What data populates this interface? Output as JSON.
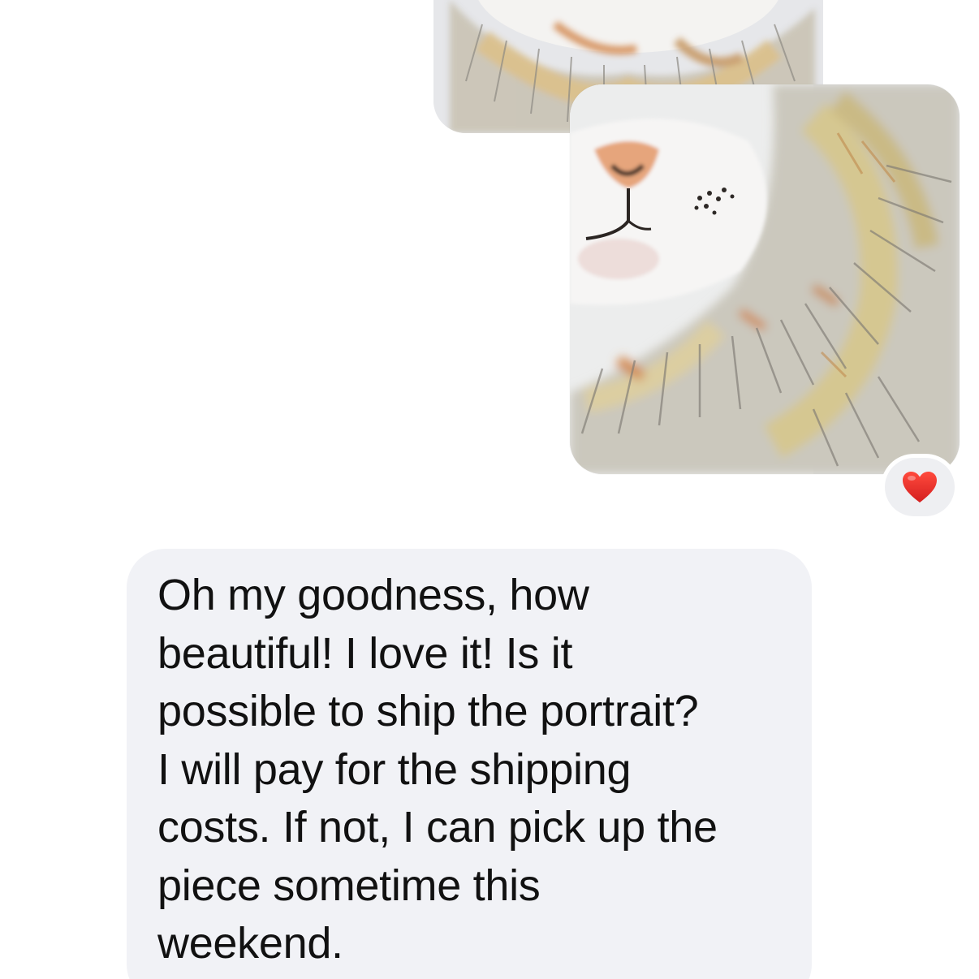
{
  "conversation": {
    "attachments": [
      {
        "kind": "photo",
        "subject": "watercolor-cat-painting",
        "crop": "chin-and-ruff"
      },
      {
        "kind": "photo",
        "subject": "watercolor-cat-painting",
        "crop": "nose-and-mane"
      }
    ],
    "reaction": {
      "emoji": "❤️",
      "icon": "heart-icon",
      "color": "#e32b2b"
    },
    "incoming_message": {
      "lines": [
        "Oh my goodness, how",
        "beautiful! I love it! Is it",
        "possible to ship the portrait?",
        "I will pay for the shipping",
        "costs. If not, I can pick up the",
        "piece sometime this",
        "weekend."
      ],
      "bubble_color": "#f1f2f6",
      "text_color": "#111111"
    }
  }
}
